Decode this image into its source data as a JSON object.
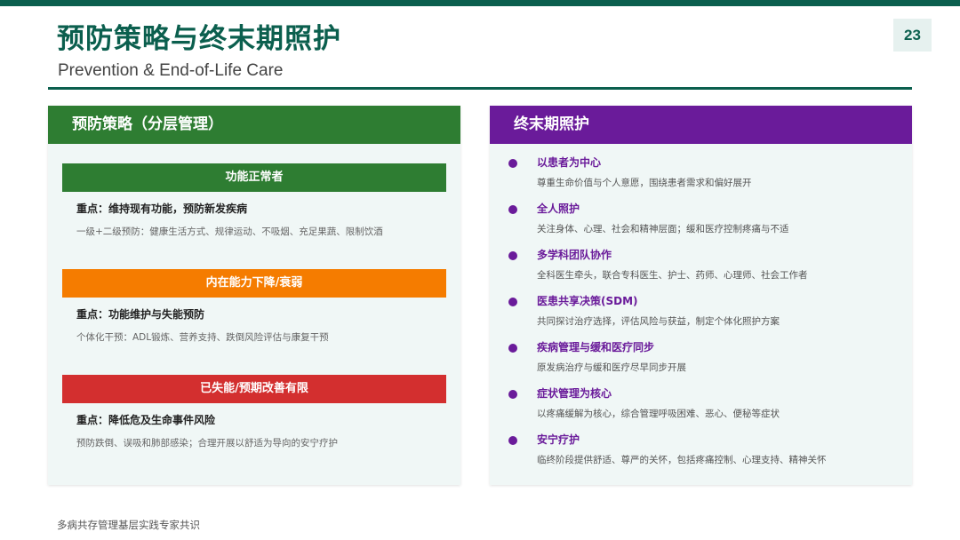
{
  "header": {
    "title": "预防策略与终末期照护",
    "subtitle": "Prevention & End-of-Life Care",
    "page_number": "23"
  },
  "colors": {
    "brand": "#0b5f4e",
    "prevention_header": "#2e7d32",
    "care_header": "#6a1b9a",
    "tier_normal": "#2e7d32",
    "tier_decline": "#f57c00",
    "tier_disabled": "#d32f2f"
  },
  "prevention": {
    "heading": "预防策略（分层管理）",
    "tiers": [
      {
        "label": "功能正常者",
        "color": "#2e7d32",
        "focus": "重点：维持现有功能，预防新发疾病",
        "desc": "一级+二级预防：健康生活方式、规律运动、不吸烟、充足果蔬、限制饮酒"
      },
      {
        "label": "内在能力下降/衰弱",
        "color": "#f57c00",
        "focus": "重点：功能维护与失能预防",
        "desc": "个体化干预：ADL锻炼、营养支持、跌倒风险评估与康复干预"
      },
      {
        "label": "已失能/预期改善有限",
        "color": "#d32f2f",
        "focus": "重点：降低危及生命事件风险",
        "desc": "预防跌倒、误吸和肺部感染；合理开展以舒适为导向的安宁疗护"
      }
    ]
  },
  "care": {
    "heading": "终末期照护",
    "items": [
      {
        "title": "以患者为中心",
        "desc": "尊重生命价值与个人意愿，围绕患者需求和偏好展开"
      },
      {
        "title": "全人照护",
        "desc": "关注身体、心理、社会和精神层面；缓和医疗控制疼痛与不适"
      },
      {
        "title": "多学科团队协作",
        "desc": "全科医生牵头，联合专科医生、护士、药师、心理师、社会工作者"
      },
      {
        "title": "医患共享决策(SDM)",
        "desc": "共同探讨治疗选择，评估风险与获益，制定个体化照护方案"
      },
      {
        "title": "疾病管理与缓和医疗同步",
        "desc": "原发病治疗与缓和医疗尽早同步开展"
      },
      {
        "title": "症状管理为核心",
        "desc": "以疼痛缓解为核心，综合管理呼吸困难、恶心、便秘等症状"
      },
      {
        "title": "安宁疗护",
        "desc": "临终阶段提供舒适、尊严的关怀，包括疼痛控制、心理支持、精神关怀"
      }
    ]
  },
  "footer": {
    "source": "多病共存管理基层实践专家共识"
  }
}
